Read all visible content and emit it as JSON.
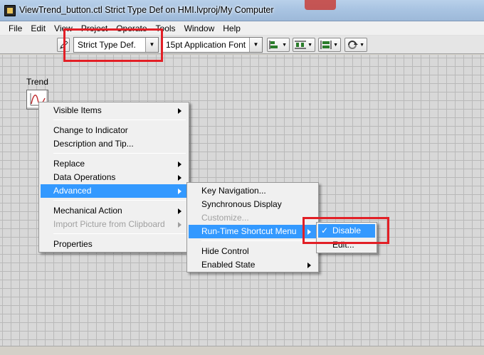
{
  "window": {
    "title": "ViewTrend_button.ctl Strict Type Def on HMI.lvproj/My Computer"
  },
  "menubar": {
    "items": [
      {
        "label": "File"
      },
      {
        "label": "Edit"
      },
      {
        "label": "View"
      },
      {
        "label": "Project"
      },
      {
        "label": "Operate"
      },
      {
        "label": "Tools"
      },
      {
        "label": "Window"
      },
      {
        "label": "Help"
      }
    ]
  },
  "toolbar": {
    "type_def_select": "Strict Type Def.",
    "font_select": "15pt Application Font",
    "icons": [
      "pencil-icon",
      "align-objects-icon",
      "distribute-objects-icon",
      "resize-objects-icon",
      "reorder-icon"
    ]
  },
  "canvas": {
    "control_label": "Trend"
  },
  "context_menu": {
    "items": [
      {
        "label": "Visible Items",
        "submenu": true
      },
      {
        "label": "Change to Indicator"
      },
      {
        "label": "Description and Tip..."
      },
      {
        "label": "Replace",
        "submenu": true
      },
      {
        "label": "Data Operations",
        "submenu": true
      },
      {
        "label": "Advanced",
        "submenu": true,
        "selected": true
      },
      {
        "label": "Mechanical Action",
        "submenu": true
      },
      {
        "label": "Import Picture from Clipboard",
        "submenu": true,
        "disabled": true
      },
      {
        "label": "Properties"
      }
    ]
  },
  "advanced_menu": {
    "items": [
      {
        "label": "Key Navigation..."
      },
      {
        "label": "Synchronous Display"
      },
      {
        "label": "Customize...",
        "disabled": true
      },
      {
        "label": "Run-Time Shortcut Menu",
        "submenu": true,
        "selected": true
      },
      {
        "label": "Hide Control"
      },
      {
        "label": "Enabled State",
        "submenu": true
      }
    ]
  },
  "shortcut_menu": {
    "items": [
      {
        "label": "Disable",
        "checked": true,
        "check_mark": "✓",
        "selected": true
      },
      {
        "label": "Edit..."
      }
    ]
  },
  "colors": {
    "highlight": "#e21f26",
    "menu_selection": "#3399ff"
  }
}
